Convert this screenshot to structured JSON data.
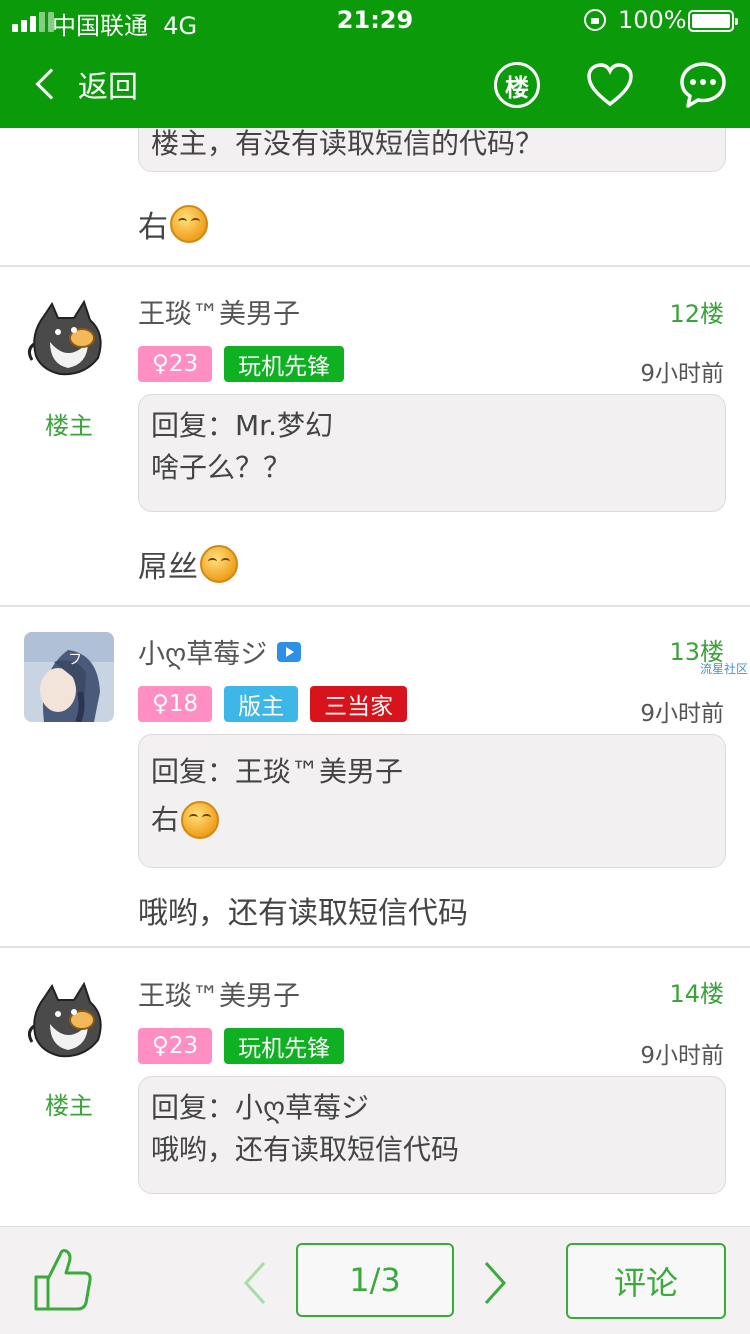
{
  "status_bar": {
    "carrier": "中国联通",
    "network": "4G",
    "time": "21:29",
    "battery": "100%"
  },
  "nav": {
    "back_label": "返回",
    "floor_icon_label": "楼"
  },
  "top_snippet": {
    "quote_text": "楼主，有没有读取短信的代码？",
    "reply_text": "右"
  },
  "posts": [
    {
      "username": "王琰™美男子",
      "floor": "12楼",
      "owner_label": "楼主",
      "gender_age": "♀23",
      "title_badge": "玩机先锋",
      "time_ago": "9小时前",
      "quote_line1": "回复：Mr.梦幻",
      "quote_line2": "啥子么？？",
      "text": "屌丝"
    },
    {
      "username": "小ღ草莓ジ",
      "floor": "13楼",
      "watermark": "流星社区",
      "gender_age": "♀18",
      "role_badge": "版主",
      "rank_badge": "三当家",
      "time_ago": "9小时前",
      "quote_line1": "回复：王琰™美男子",
      "quote_line2": "右",
      "text": "哦哟，还有读取短信代码"
    },
    {
      "username": "王琰™美男子",
      "floor": "14楼",
      "owner_label": "楼主",
      "gender_age": "♀23",
      "title_badge": "玩机先锋",
      "time_ago": "9小时前",
      "quote_line1": "回复：小ღ草莓ジ",
      "quote_line2": "哦哟，还有读取短信代码"
    }
  ],
  "bottom": {
    "page": "1/3",
    "comment_label": "评论"
  },
  "colors": {
    "brand_green": "#0a9a0a",
    "accent_green": "#3aa33a",
    "pink_badge": "#ff8ec2",
    "green_badge": "#10b023",
    "blue_badge": "#3fb6e8",
    "red_badge": "#d7141c"
  }
}
